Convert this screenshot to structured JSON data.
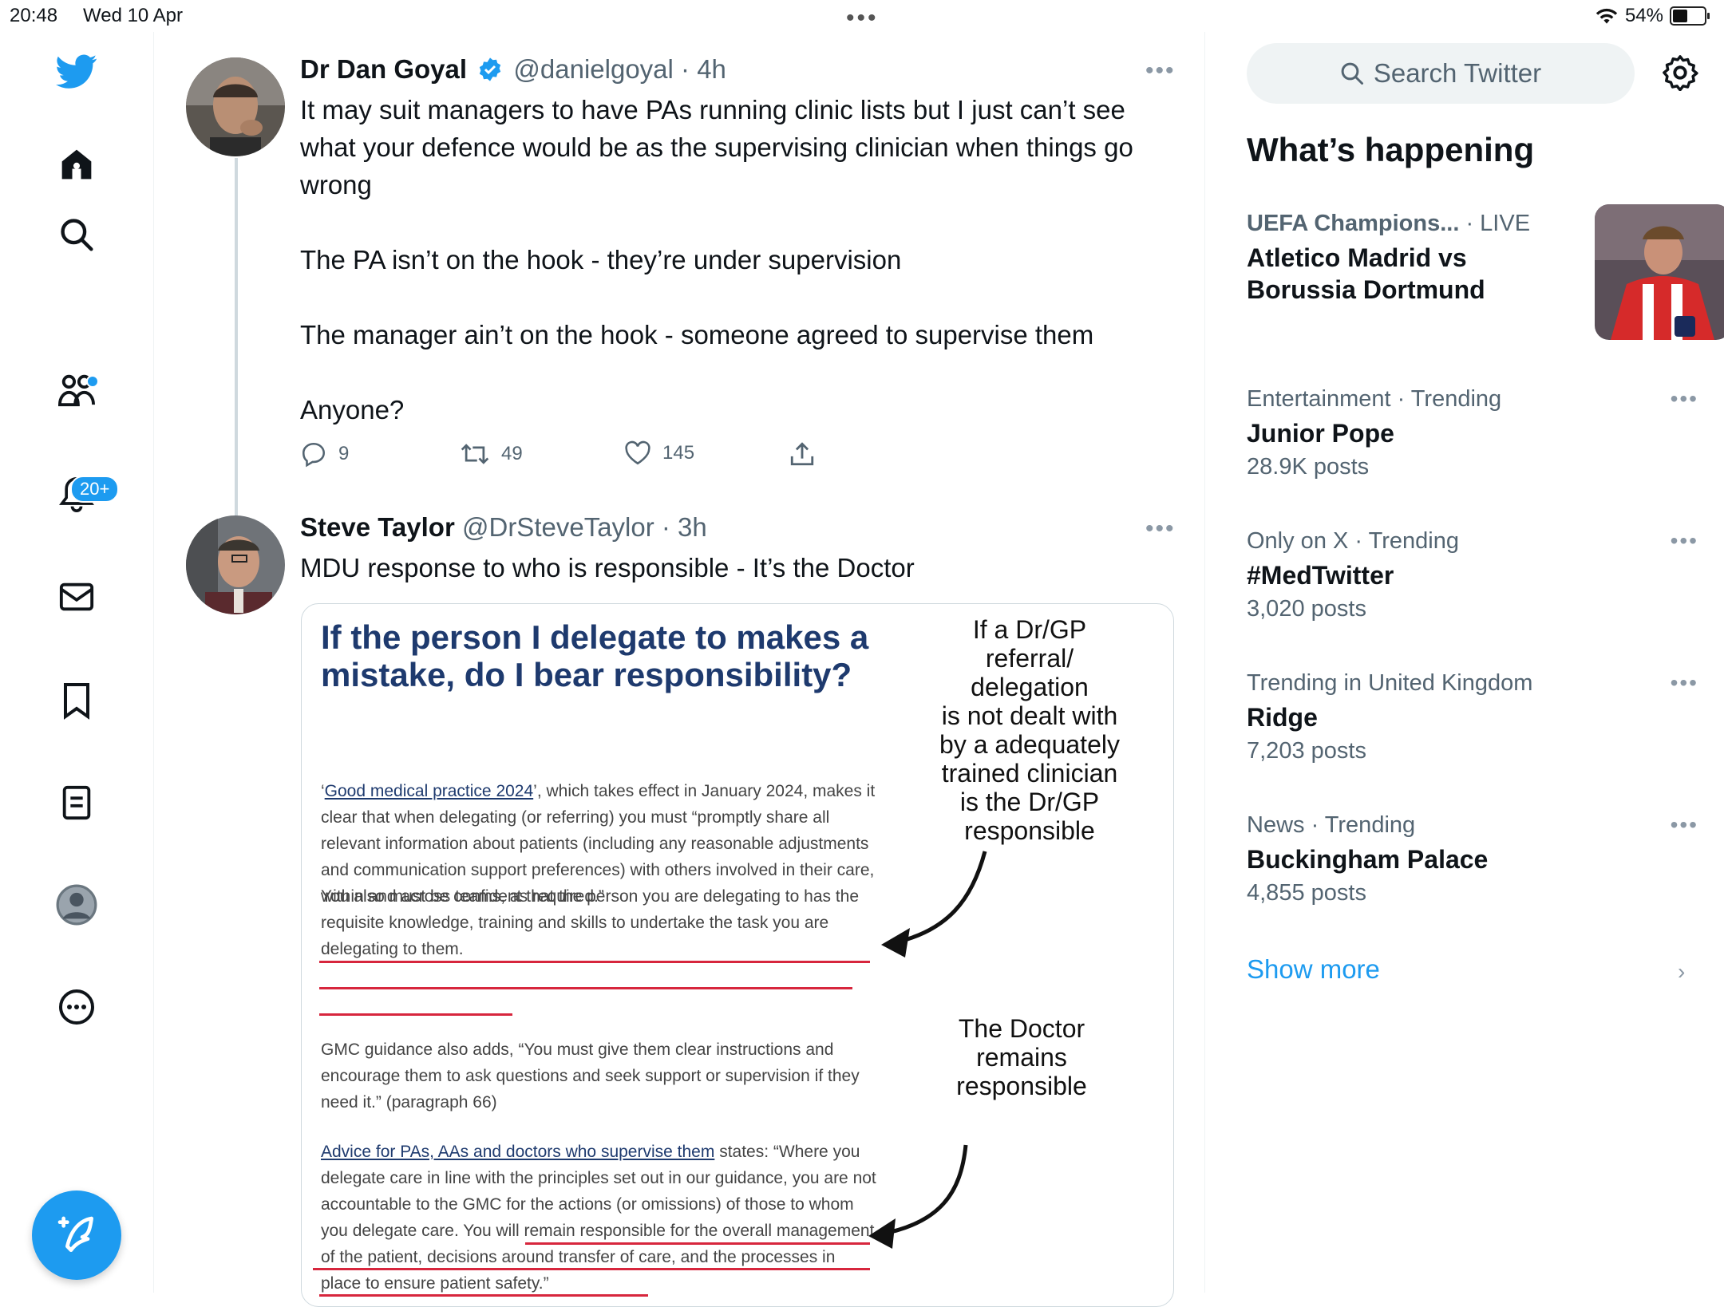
{
  "status_bar": {
    "time": "20:48",
    "date": "Wed 10 Apr",
    "battery": "54%",
    "battery_level": 0.54
  },
  "nav": {
    "items": [
      {
        "icon": "twitter-logo-icon"
      },
      {
        "icon": "home-icon"
      },
      {
        "icon": "search-icon"
      },
      {
        "icon": "communities-icon"
      },
      {
        "icon": "notifications-icon"
      },
      {
        "icon": "messages-icon"
      },
      {
        "icon": "bookmarks-icon"
      },
      {
        "icon": "lists-icon"
      },
      {
        "icon": "profile-icon"
      },
      {
        "icon": "more-icon"
      }
    ],
    "notifications_badge": "20+",
    "compose_icon": "compose-icon"
  },
  "tweets": [
    {
      "name": "Dr Dan Goyal",
      "verified": true,
      "handle": "@danielgoyal",
      "time": "4h",
      "text": "It may suit managers to have PAs running clinic lists but I just can’t see what your defence would be as the supervising clinician when things go wrong\n\nThe PA isn’t on the hook - they’re under supervision\n\nThe manager ain’t on the hook - someone agreed to supervise them\n\nAnyone?",
      "replies": "9",
      "retweets": "49",
      "likes": "145"
    },
    {
      "name": "Steve Taylor",
      "handle": "@DrSteveTaylor",
      "time": "3h",
      "text": "MDU response to who is responsible - It’s the Doctor"
    }
  ],
  "embedded_image": {
    "title": "If the person I delegate to makes a mistake, do I bear responsibility?",
    "p1_link": "Good medical practice 2024",
    "p1_pre": "‘",
    "p1_rest": "’, which takes effect in January 2024, makes it clear that when delegating (or referring) you must “promptly share all relevant information about patients (including any reasonable adjustments and communication support preferences) with others involved in their care, within and across teams, as required.”",
    "p2": "You also must be confident that the person you are delegating to has the requisite knowledge, training and skills to undertake the task you are delegating to them.",
    "p3": "GMC guidance also adds, “You must give them clear instructions and encourage them to ask questions and seek support or supervision if they need it.” (paragraph 66)",
    "p4_link": "Advice for PAs, AAs and doctors who supervise them",
    "p4_rest": " states: “Where you delegate care in line with the principles set out in our guidance, you are not accountable to the GMC for the actions (or omissions) of those to whom you delegate care. You will remain responsible for the overall management of the patient, decisions around transfer of care, and the processes in place to ensure patient safety.”",
    "note1": "If a Dr/GP\nreferral/\ndelegation\nis not dealt with\nby a adequately\ntrained clinician\nis the Dr/GP\nresponsible",
    "note2": "The Doctor\nremains\nresponsible"
  },
  "sidebar": {
    "search_placeholder": "Search Twitter",
    "heading": "What’s happening",
    "live": {
      "context": "UEFA Champions...",
      "live_label": "· LIVE",
      "title": "Atletico Madrid vs Borussia Dortmund"
    },
    "trends": [
      {
        "context": "Entertainment · Trending",
        "title": "Junior Pope",
        "count": "28.9K posts"
      },
      {
        "context": "Only on X · Trending",
        "title": "#MedTwitter",
        "count": "3,020 posts"
      },
      {
        "context": "Trending in United Kingdom",
        "title": "Ridge",
        "count": "7,203 posts"
      },
      {
        "context": "News · Trending",
        "title": "Buckingham Palace",
        "count": "4,855 posts"
      }
    ],
    "show_more": "Show more"
  }
}
